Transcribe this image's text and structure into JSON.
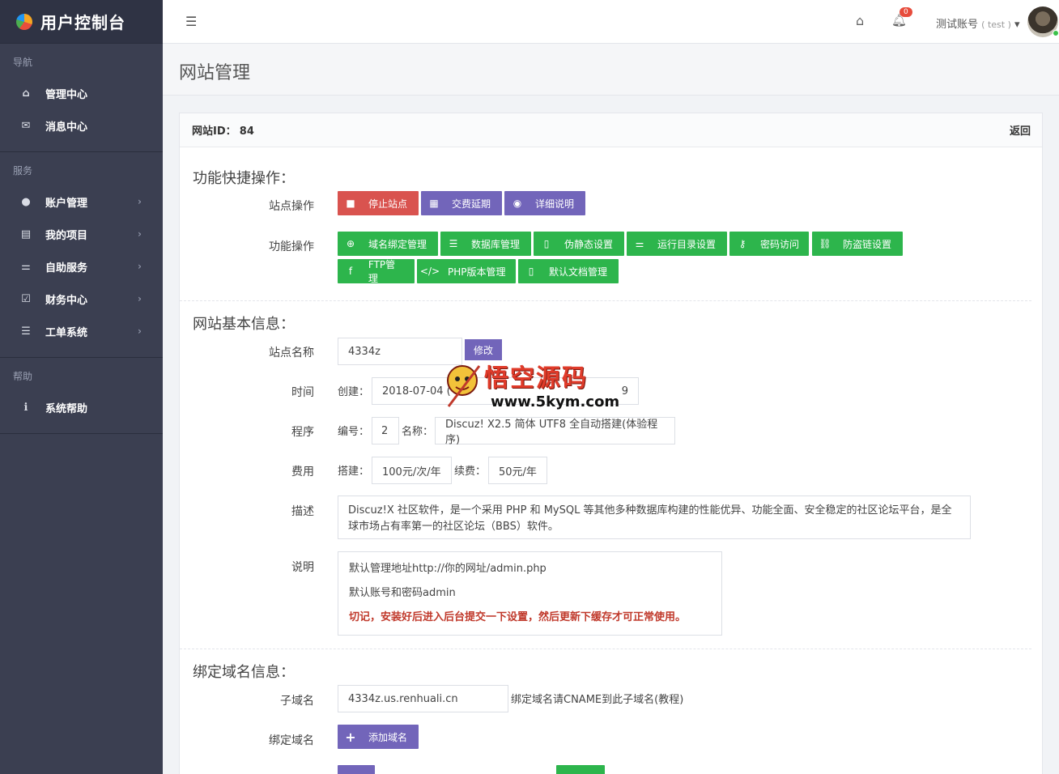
{
  "brand": {
    "title": "用户控制台"
  },
  "sidebar": {
    "sections": [
      {
        "header": "导航",
        "items": [
          {
            "label": "管理中心",
            "icon": "home-icon",
            "glyph": "⌂",
            "chevron": false
          },
          {
            "label": "消息中心",
            "icon": "mail-icon",
            "glyph": "✉",
            "chevron": false
          }
        ]
      },
      {
        "header": "服务",
        "items": [
          {
            "label": "账户管理",
            "icon": "user-icon",
            "glyph": "●",
            "chevron": true
          },
          {
            "label": "我的项目",
            "icon": "list-icon",
            "glyph": "▤",
            "chevron": true
          },
          {
            "label": "自助服务",
            "icon": "sliders-icon",
            "glyph": "⚌",
            "chevron": true
          },
          {
            "label": "财务中心",
            "icon": "check-square-icon",
            "glyph": "☑",
            "chevron": true
          },
          {
            "label": "工单系统",
            "icon": "menu-icon",
            "glyph": "☰",
            "chevron": true
          }
        ]
      },
      {
        "header": "帮助",
        "items": [
          {
            "label": "系统帮助",
            "icon": "info-icon",
            "glyph": "ℹ",
            "chevron": false
          }
        ]
      }
    ]
  },
  "topbar": {
    "notification_count": "0",
    "user_name": "测试账号",
    "user_sub": "( test )",
    "dropdown": "▾"
  },
  "page": {
    "title": "网站管理"
  },
  "card": {
    "id_label": "网站ID：",
    "id_value": "84",
    "back": "返回"
  },
  "quick": {
    "title": "功能快捷操作：",
    "site_ops_label": "站点操作",
    "site_ops": [
      "停止站点",
      "交费延期",
      "详细说明"
    ],
    "func_ops_label": "功能操作",
    "func_ops": [
      "域名绑定管理",
      "数据库管理",
      "伪静态设置",
      "运行目录设置",
      "密码访问",
      "防盗链设置",
      "FTP管理",
      "PHP版本管理",
      "默认文档管理"
    ]
  },
  "basic": {
    "title": "网站基本信息：",
    "name_label": "站点名称",
    "name_value": "4334z",
    "edit": "修改",
    "time_label": "时间",
    "created_label": "创建：",
    "created_value": "2018-07-04 (",
    "expire_tail": "9",
    "program_label": "程序",
    "num_label": "编号：",
    "num_value": "2",
    "pname_label": "名称：",
    "pname_value": "Discuz! X2.5 简体 UTF8 全自动搭建(体验程序)",
    "fee_label": "费用",
    "build_label": "搭建：",
    "build_value": "100元/次/年",
    "renew_label": "续费：",
    "renew_value": "50元/年",
    "desc_label": "描述",
    "desc_value": "Discuz!X 社区软件，是一个采用 PHP 和 MySQL 等其他多种数据库构建的性能优异、功能全面、安全稳定的社区论坛平台，是全球市场占有率第一的社区论坛（BBS）软件。",
    "note_label": "说明",
    "note_lines": [
      "默认管理地址http://你的网址/admin.php",
      "默认账号和密码admin"
    ],
    "note_warn": "切记，安装好后进入后台提交一下设置，然后更新下缓存才可正常使用。"
  },
  "domain": {
    "title": "绑定域名信息：",
    "sub_label": "子域名",
    "sub_value": "4334z.us.renhuali.cn",
    "sub_hint": "绑定域名请CNAME到此子域名(教程)",
    "bind_label": "绑定域名",
    "add": "添加域名"
  },
  "watermark": {
    "title": "悟空源码",
    "url": "www.5kym.com"
  },
  "colors": {
    "sidebar": "#3b3f51",
    "purple": "#7265ba",
    "green": "#2db54c",
    "red": "#d9534f"
  }
}
